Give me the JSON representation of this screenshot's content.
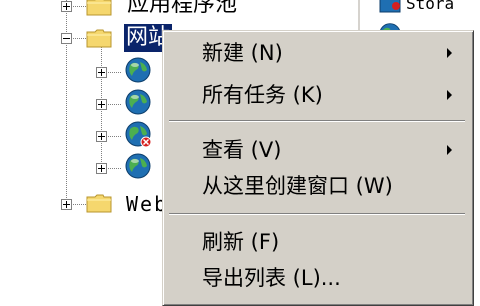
{
  "tree": {
    "items": [
      {
        "label": "应用程序池",
        "icon": "folder-icon",
        "expander": "plus"
      },
      {
        "label": "网站",
        "icon": "folder-icon",
        "expander": "minus",
        "selected": true
      },
      {
        "label": "",
        "icon": "globe-icon",
        "expander": "plus"
      },
      {
        "label": "",
        "icon": "globe-icon",
        "expander": "plus"
      },
      {
        "label": "",
        "icon": "globe-stopped-icon",
        "expander": "plus"
      },
      {
        "label": "",
        "icon": "globe-icon",
        "expander": "plus"
      },
      {
        "label": "Web",
        "icon": "folder-icon",
        "expander": "plus"
      }
    ]
  },
  "right_pane": {
    "partial_text": "Stora"
  },
  "context_menu": {
    "items": [
      {
        "label": "新建 (N)",
        "submenu": true
      },
      {
        "label": "所有任务 (K)",
        "submenu": true
      },
      {
        "label": "查看 (V)",
        "submenu": true
      },
      {
        "label": "从这里创建窗口 (W)",
        "submenu": false
      },
      {
        "label": "刷新 (F)",
        "submenu": false
      },
      {
        "label": "导出列表 (L)...",
        "submenu": false
      }
    ]
  },
  "colors": {
    "menu_bg": "#d4d0c8",
    "selection_bg": "#0a246a",
    "folder_yellow": "#f5d76e",
    "globe_blue": "#1f6fb2"
  }
}
